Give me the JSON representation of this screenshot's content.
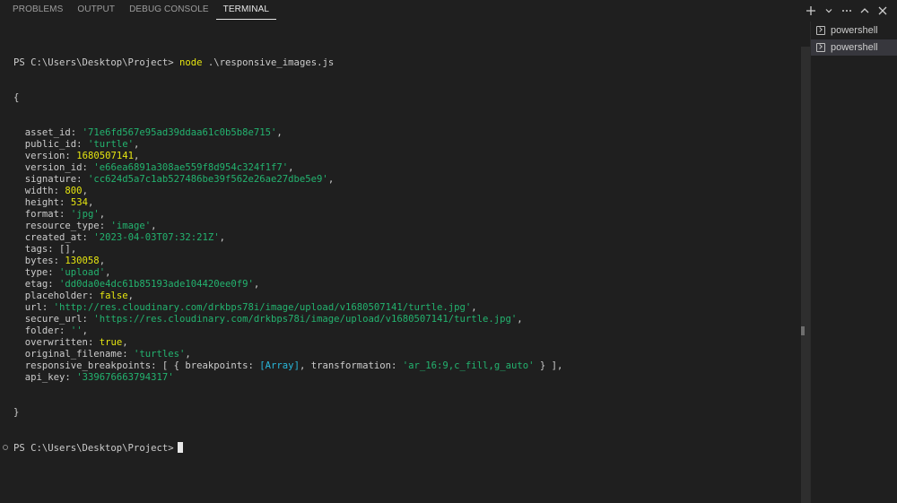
{
  "panel": {
    "tabs": [
      "PROBLEMS",
      "OUTPUT",
      "DEBUG CONSOLE",
      "TERMINAL"
    ],
    "active_tab": "TERMINAL",
    "actions": [
      {
        "icon": "plus-icon",
        "glyph": "+"
      },
      {
        "icon": "chevron-down-icon",
        "glyph": "⌄"
      },
      {
        "icon": "more-icon",
        "glyph": "···"
      },
      {
        "icon": "chevron-up-icon",
        "glyph": "︿"
      },
      {
        "icon": "close-icon",
        "glyph": "✕"
      }
    ]
  },
  "terminal": {
    "prompt": "PS C:\\Users\\Desktop\\Project>",
    "command": "node",
    "command_arg": ".\\responsive_images.js",
    "open_brace": "{",
    "close_brace": "}",
    "fields": [
      {
        "key": "asset_id",
        "value": "'71e6fd567e95ad39ddaa61c0b5b8e715'",
        "type": "str"
      },
      {
        "key": "public_id",
        "value": "'turtle'",
        "type": "str"
      },
      {
        "key": "version",
        "value": "1680507141",
        "type": "num"
      },
      {
        "key": "version_id",
        "value": "'e66ea6891a308ae559f8d954c324f1f7'",
        "type": "str"
      },
      {
        "key": "signature",
        "value": "'cc624d5a7c1ab527486be39f562e26ae27dbe5e9'",
        "type": "str"
      },
      {
        "key": "width",
        "value": "800",
        "type": "num"
      },
      {
        "key": "height",
        "value": "534",
        "type": "num"
      },
      {
        "key": "format",
        "value": "'jpg'",
        "type": "str"
      },
      {
        "key": "resource_type",
        "value": "'image'",
        "type": "str"
      },
      {
        "key": "created_at",
        "value": "'2023-04-03T07:32:21Z'",
        "type": "str"
      },
      {
        "key": "tags",
        "value": "[]",
        "type": "plain"
      },
      {
        "key": "bytes",
        "value": "130058",
        "type": "num"
      },
      {
        "key": "type",
        "value": "'upload'",
        "type": "str"
      },
      {
        "key": "etag",
        "value": "'dd0da0e4dc61b85193ade104420ee0f9'",
        "type": "str"
      },
      {
        "key": "placeholder",
        "value": "false",
        "type": "num"
      },
      {
        "key": "url",
        "value": "'http://res.cloudinary.com/drkbps78i/image/upload/v1680507141/turtle.jpg'",
        "type": "str"
      },
      {
        "key": "secure_url",
        "value": "'https://res.cloudinary.com/drkbps78i/image/upload/v1680507141/turtle.jpg'",
        "type": "str"
      },
      {
        "key": "folder",
        "value": "''",
        "type": "str"
      },
      {
        "key": "overwritten",
        "value": "true",
        "type": "num"
      },
      {
        "key": "original_filename",
        "value": "'turtles'",
        "type": "str"
      },
      {
        "key": "api_key",
        "value": "'339676663794317'",
        "type": "str",
        "last": true
      }
    ],
    "breakpoints_line": {
      "key": "responsive_breakpoints",
      "open": "[ { breakpoints: ",
      "array": "[Array]",
      "mid": ", transformation: ",
      "transformation": "'ar_16:9,c_fill,g_auto'",
      "close": " } ],"
    }
  },
  "terminal_list": {
    "items": [
      {
        "label": "powershell",
        "icon": "terminal-icon"
      },
      {
        "label": "powershell",
        "icon": "terminal-icon",
        "active": true
      }
    ]
  }
}
